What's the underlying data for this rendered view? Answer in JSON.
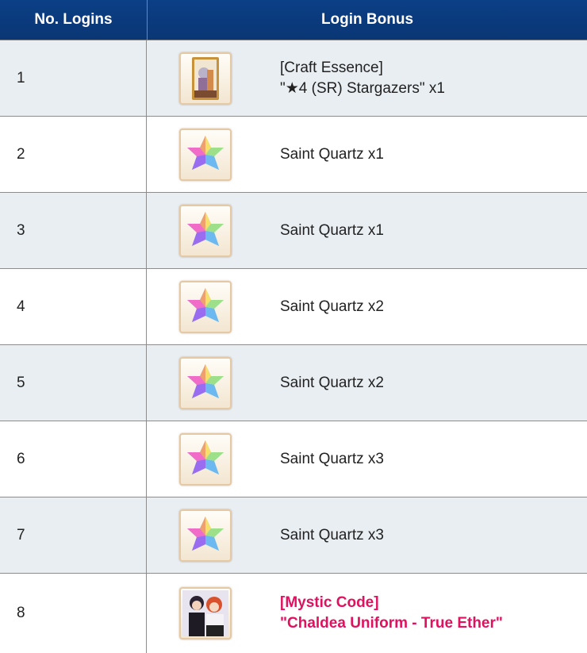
{
  "header": {
    "col1": "No. Logins",
    "col2": "Login Bonus"
  },
  "rows": [
    {
      "num": "1",
      "icon": "craft-essence-card-icon",
      "line1": "[Craft Essence]",
      "line2": "\"★4 (SR) Stargazers\" x1"
    },
    {
      "num": "2",
      "icon": "saint-quartz-icon",
      "line1": "Saint Quartz x1",
      "line2": ""
    },
    {
      "num": "3",
      "icon": "saint-quartz-icon",
      "line1": "Saint Quartz x1",
      "line2": ""
    },
    {
      "num": "4",
      "icon": "saint-quartz-icon",
      "line1": "Saint Quartz x2",
      "line2": ""
    },
    {
      "num": "5",
      "icon": "saint-quartz-icon",
      "line1": "Saint Quartz x2",
      "line2": ""
    },
    {
      "num": "6",
      "icon": "saint-quartz-icon",
      "line1": "Saint Quartz x3",
      "line2": ""
    },
    {
      "num": "7",
      "icon": "saint-quartz-icon",
      "line1": "Saint Quartz x3",
      "line2": ""
    },
    {
      "num": "8",
      "icon": "mystic-code-icon",
      "line1": "[Mystic Code]",
      "line2": "\"Chaldea Uniform - True Ether\""
    }
  ],
  "colors": {
    "header_bg": "#0b3f86",
    "row_alt": "#e9eef2",
    "special_text": "#e0115f"
  }
}
